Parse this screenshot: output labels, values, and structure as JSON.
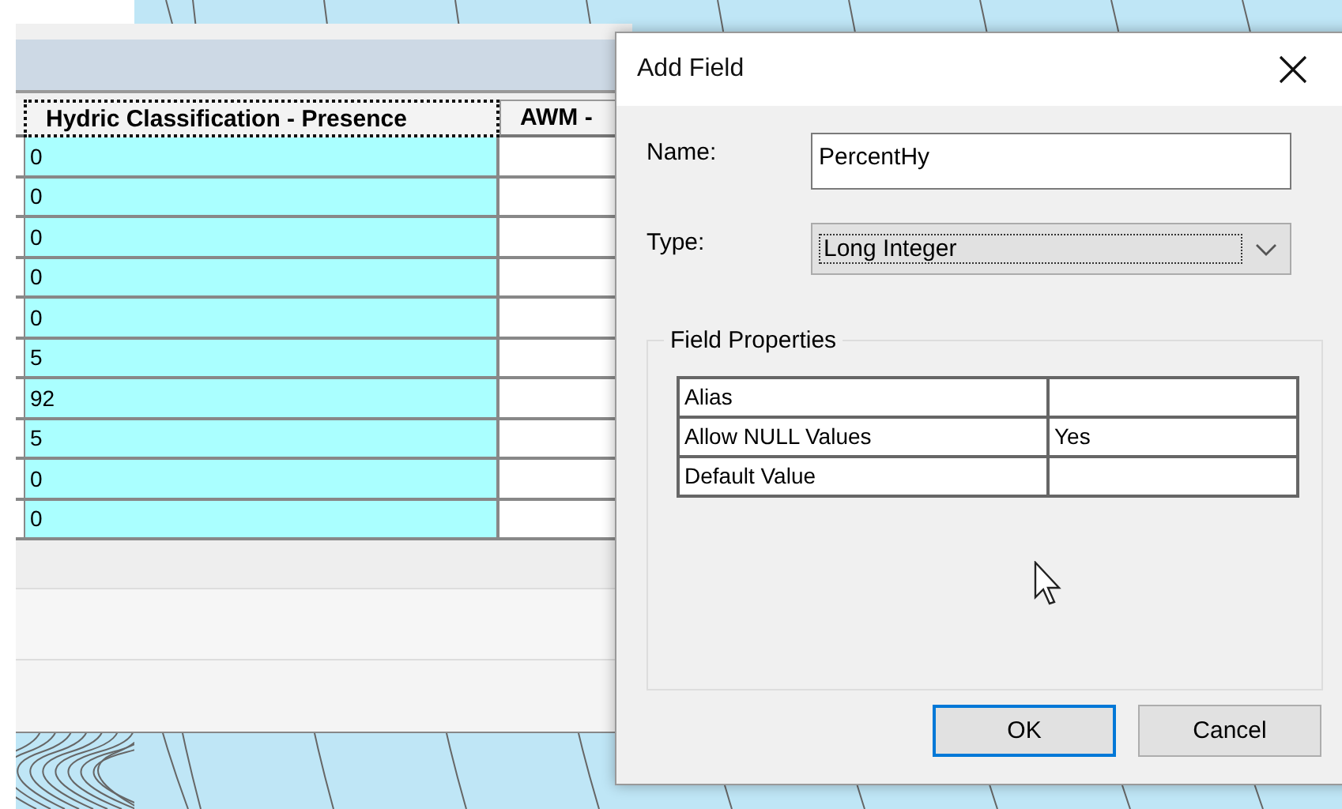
{
  "table": {
    "columns": [
      {
        "label": "Hydric Classification - Presence",
        "selected": true
      },
      {
        "label": "AWM -",
        "selected": false
      }
    ],
    "rows": [
      "0",
      "0",
      "0",
      "0",
      "0",
      "5",
      "92",
      "5",
      "0",
      "0"
    ]
  },
  "dialog": {
    "title": "Add Field",
    "fields": [
      {
        "kind": "text",
        "label": "Name:",
        "value": "PercentHy"
      },
      {
        "kind": "dropdown",
        "label": "Type:",
        "value": "Long Integer"
      }
    ],
    "group": {
      "title": "Field Properties",
      "rows": [
        {
          "property": "Alias"
        },
        {
          "property": "Allow NULL Values",
          "value": "Yes"
        },
        {
          "property": "Default Value"
        }
      ]
    },
    "buttons": [
      {
        "label": "OK",
        "default": true
      },
      {
        "label": "Cancel",
        "default": false
      }
    ]
  }
}
